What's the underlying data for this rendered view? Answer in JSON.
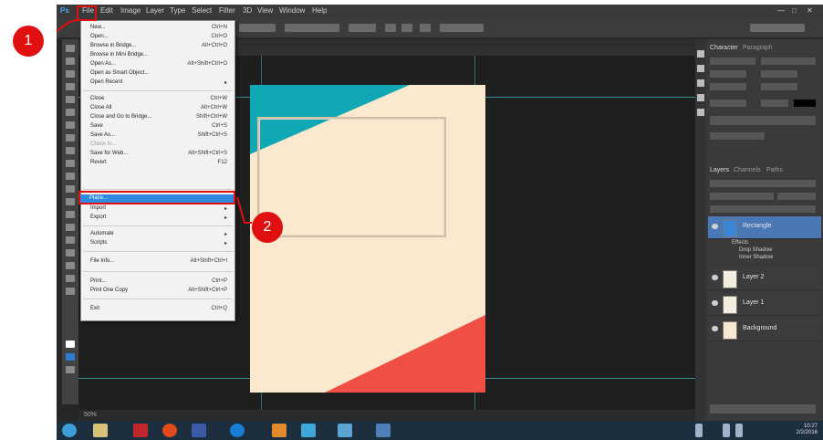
{
  "app": {
    "menubar": {
      "logo": "Ps",
      "items": [
        "File",
        "Edit",
        "Image",
        "Layer",
        "Type",
        "Select",
        "Filter",
        "3D",
        "View",
        "Window",
        "Help"
      ]
    },
    "file_menu": {
      "items": [
        {
          "label": "New...",
          "shortcut": "Ctrl+N"
        },
        {
          "label": "Open...",
          "shortcut": "Ctrl+O"
        },
        {
          "label": "Browse in Bridge...",
          "shortcut": "Alt+Ctrl+O"
        },
        {
          "label": "Browse in Mini Bridge...",
          "shortcut": ""
        },
        {
          "label": "Open As...",
          "shortcut": "Alt+Shift+Ctrl+O"
        },
        {
          "label": "Open as Smart Object...",
          "shortcut": ""
        },
        {
          "label": "Open Recent",
          "shortcut": "▸"
        },
        {
          "label": "Close",
          "shortcut": "Ctrl+W"
        },
        {
          "label": "Close All",
          "shortcut": "Alt+Ctrl+W"
        },
        {
          "label": "Close and Go to Bridge...",
          "shortcut": "Shift+Ctrl+W"
        },
        {
          "label": "Save",
          "shortcut": "Ctrl+S"
        },
        {
          "label": "Save As...",
          "shortcut": "Shift+Ctrl+S"
        },
        {
          "label": "Check In...",
          "shortcut": ""
        },
        {
          "label": "Save for Web...",
          "shortcut": "Alt+Shift+Ctrl+S"
        },
        {
          "label": "Revert",
          "shortcut": "F12"
        },
        {
          "label": "Place...",
          "shortcut": ""
        },
        {
          "label": "Import",
          "shortcut": "▸"
        },
        {
          "label": "Export",
          "shortcut": "▸"
        },
        {
          "label": "Automate",
          "shortcut": "▸"
        },
        {
          "label": "Scripts",
          "shortcut": "▸"
        },
        {
          "label": "File Info...",
          "shortcut": "Alt+Shift+Ctrl+I"
        },
        {
          "label": "Print...",
          "shortcut": "Ctrl+P"
        },
        {
          "label": "Print One Copy",
          "shortcut": "Alt+Shift+Ctrl+P"
        },
        {
          "label": "Exit",
          "shortcut": "Ctrl+Q"
        }
      ]
    },
    "panels": {
      "tabs": [
        "Character",
        "Paragraph"
      ],
      "layers_tabs": [
        "Layers",
        "Channels",
        "Paths"
      ],
      "layers": [
        {
          "name": "Rectangle",
          "selected": true
        },
        {
          "name": "Layer 2",
          "selected": false
        },
        {
          "name": "Layer 1",
          "selected": false
        },
        {
          "name": "Background",
          "selected": false
        }
      ],
      "effects": [
        "Effects",
        "Drop Shadow",
        "Inner Shadow"
      ]
    },
    "status": {
      "zoom": "50%"
    },
    "taskbar": {
      "time": "10:27",
      "date": "2/2/2016"
    }
  },
  "annotations": {
    "callout_1": "1",
    "callout_2": "2",
    "color": "#e01010"
  },
  "colors": {
    "artboard": "#fae8cf",
    "teal_triangle": "#11a8b5",
    "red_triangle": "#f04f45",
    "highlight": "#2f8be0",
    "workspace": "#262626"
  }
}
